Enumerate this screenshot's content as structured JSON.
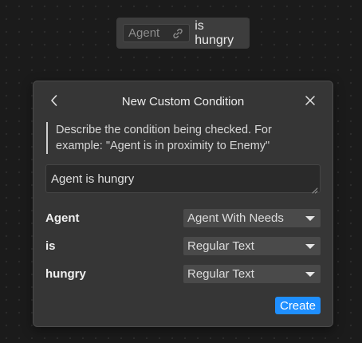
{
  "condition_chip": {
    "token_label": "Agent",
    "token_icon": "link-icon",
    "text": "is hungry"
  },
  "dialog": {
    "title": "New Custom Condition",
    "back_icon": "chevron-left-icon",
    "close_icon": "close-icon",
    "hint": "Describe the condition being checked. For example: \"Agent is in proximity to Enemy\"",
    "description_value": "Agent is hungry",
    "rows": [
      {
        "label": "Agent",
        "select_value": "Agent With Needs"
      },
      {
        "label": "is",
        "select_value": "Regular Text"
      },
      {
        "label": "hungry",
        "select_value": "Regular Text"
      }
    ],
    "create_label": "Create"
  },
  "colors": {
    "background": "#1b1b1b",
    "dialog_bg": "#363636",
    "accent": "#1f8fff",
    "select_bg": "#4a4a4a"
  }
}
